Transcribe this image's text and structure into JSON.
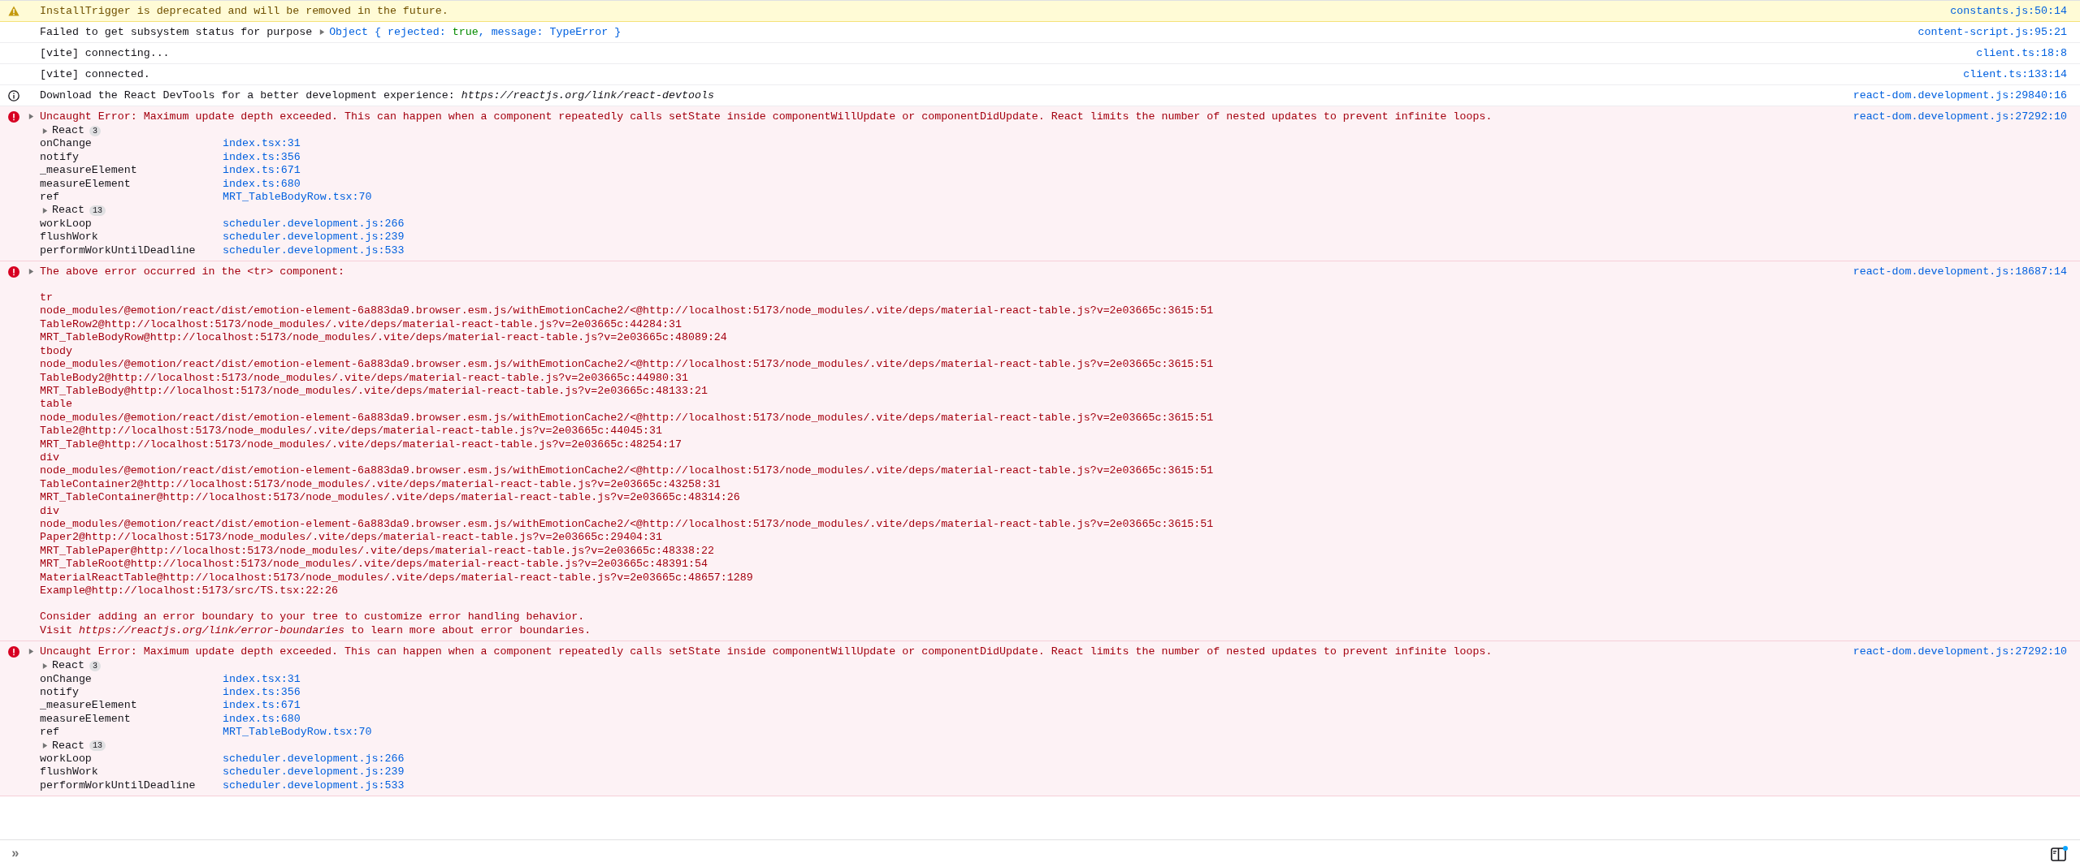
{
  "messages": [
    {
      "kind": "warning",
      "text": "InstallTrigger is deprecated and will be removed in the future.",
      "location": "constants.js:50:14"
    },
    {
      "kind": "log",
      "text": "Failed to get subsystem status for purpose",
      "object": {
        "expanded": false,
        "parts": [
          {
            "kind": "plain",
            "text": "Object { rejected: "
          },
          {
            "kind": "boolean",
            "text": "true"
          },
          {
            "kind": "plain",
            "text": ", message: TypeError }"
          }
        ]
      },
      "location": "content-script.js:95:21"
    },
    {
      "kind": "log",
      "text": "[vite] connecting...",
      "location": "client.ts:18:8"
    },
    {
      "kind": "log",
      "text": "[vite] connected.",
      "location": "client.ts:133:14"
    },
    {
      "kind": "info",
      "text": "Download the React DevTools for a better development experience: *https://reactjs.org/link/react-devtools*",
      "location": "react-dom.development.js:29840:16"
    },
    {
      "kind": "error",
      "expanded": false,
      "text": "Uncaught Error: Maximum update depth exceeded. This can happen when a component repeatedly calls setState inside componentWillUpdate or componentDidUpdate. React limits the number of nested updates to prevent infinite loops.",
      "location": "react-dom.development.js:27292:10",
      "stack": [
        {
          "kind": "group",
          "label": "React",
          "count": "3",
          "expanded": false
        },
        {
          "kind": "frame",
          "name": "onChange",
          "file": "index.tsx:31"
        },
        {
          "kind": "frame",
          "name": "notify",
          "file": "index.ts:356"
        },
        {
          "kind": "frame",
          "name": "_measureElement",
          "file": "index.ts:671"
        },
        {
          "kind": "frame",
          "name": "measureElement",
          "file": "index.ts:680"
        },
        {
          "kind": "frame",
          "name": "ref",
          "file": "MRT_TableBodyRow.tsx:70"
        },
        {
          "kind": "group",
          "label": "React",
          "count": "13",
          "expanded": false
        },
        {
          "kind": "frame",
          "name": "workLoop",
          "file": "scheduler.development.js:266"
        },
        {
          "kind": "frame",
          "name": "flushWork",
          "file": "scheduler.development.js:239"
        },
        {
          "kind": "frame",
          "name": "performWorkUntilDeadline",
          "file": "scheduler.development.js:533"
        }
      ]
    },
    {
      "kind": "error",
      "expanded": false,
      "text": "The above error occurred in the <tr> component:",
      "location": "react-dom.development.js:18687:14",
      "paragraphs": [
        [
          "tr",
          "node_modules/@emotion/react/dist/emotion-element-6a883da9.browser.esm.js/withEmotionCache2/<@http://localhost:5173/node_modules/.vite/deps/material-react-table.js?v=2e03665c:3615:51",
          "TableRow2@http://localhost:5173/node_modules/.vite/deps/material-react-table.js?v=2e03665c:44284:31",
          "MRT_TableBodyRow@http://localhost:5173/node_modules/.vite/deps/material-react-table.js?v=2e03665c:48089:24",
          "tbody",
          "node_modules/@emotion/react/dist/emotion-element-6a883da9.browser.esm.js/withEmotionCache2/<@http://localhost:5173/node_modules/.vite/deps/material-react-table.js?v=2e03665c:3615:51",
          "TableBody2@http://localhost:5173/node_modules/.vite/deps/material-react-table.js?v=2e03665c:44980:31",
          "MRT_TableBody@http://localhost:5173/node_modules/.vite/deps/material-react-table.js?v=2e03665c:48133:21",
          "table",
          "node_modules/@emotion/react/dist/emotion-element-6a883da9.browser.esm.js/withEmotionCache2/<@http://localhost:5173/node_modules/.vite/deps/material-react-table.js?v=2e03665c:3615:51",
          "Table2@http://localhost:5173/node_modules/.vite/deps/material-react-table.js?v=2e03665c:44045:31",
          "MRT_Table@http://localhost:5173/node_modules/.vite/deps/material-react-table.js?v=2e03665c:48254:17",
          "div",
          "node_modules/@emotion/react/dist/emotion-element-6a883da9.browser.esm.js/withEmotionCache2/<@http://localhost:5173/node_modules/.vite/deps/material-react-table.js?v=2e03665c:3615:51",
          "TableContainer2@http://localhost:5173/node_modules/.vite/deps/material-react-table.js?v=2e03665c:43258:31",
          "MRT_TableContainer@http://localhost:5173/node_modules/.vite/deps/material-react-table.js?v=2e03665c:48314:26",
          "div",
          "node_modules/@emotion/react/dist/emotion-element-6a883da9.browser.esm.js/withEmotionCache2/<@http://localhost:5173/node_modules/.vite/deps/material-react-table.js?v=2e03665c:3615:51",
          "Paper2@http://localhost:5173/node_modules/.vite/deps/material-react-table.js?v=2e03665c:29404:31",
          "MRT_TablePaper@http://localhost:5173/node_modules/.vite/deps/material-react-table.js?v=2e03665c:48338:22",
          "MRT_TableRoot@http://localhost:5173/node_modules/.vite/deps/material-react-table.js?v=2e03665c:48391:54",
          "MaterialReactTable@http://localhost:5173/node_modules/.vite/deps/material-react-table.js?v=2e03665c:48657:1289",
          "Example@http://localhost:5173/src/TS.tsx:22:26"
        ],
        [
          "Consider adding an error boundary to your tree to customize error handling behavior.",
          "Visit *https://reactjs.org/link/error-boundaries* to learn more about error boundaries."
        ]
      ]
    },
    {
      "kind": "error",
      "expanded": false,
      "text": "Uncaught Error: Maximum update depth exceeded. This can happen when a component repeatedly calls setState inside componentWillUpdate or componentDidUpdate. React limits the number of nested updates to prevent infinite loops.",
      "location": "react-dom.development.js:27292:10",
      "stack": [
        {
          "kind": "group",
          "label": "React",
          "count": "3",
          "expanded": false
        },
        {
          "kind": "frame",
          "name": "onChange",
          "file": "index.tsx:31"
        },
        {
          "kind": "frame",
          "name": "notify",
          "file": "index.ts:356"
        },
        {
          "kind": "frame",
          "name": "_measureElement",
          "file": "index.ts:671"
        },
        {
          "kind": "frame",
          "name": "measureElement",
          "file": "index.ts:680"
        },
        {
          "kind": "frame",
          "name": "ref",
          "file": "MRT_TableBodyRow.tsx:70"
        },
        {
          "kind": "group",
          "label": "React",
          "count": "13",
          "expanded": false
        },
        {
          "kind": "frame",
          "name": "workLoop",
          "file": "scheduler.development.js:266"
        },
        {
          "kind": "frame",
          "name": "flushWork",
          "file": "scheduler.development.js:239"
        },
        {
          "kind": "frame",
          "name": "performWorkUntilDeadline",
          "file": "scheduler.development.js:533"
        }
      ]
    }
  ],
  "input": {
    "prompt": "»"
  }
}
